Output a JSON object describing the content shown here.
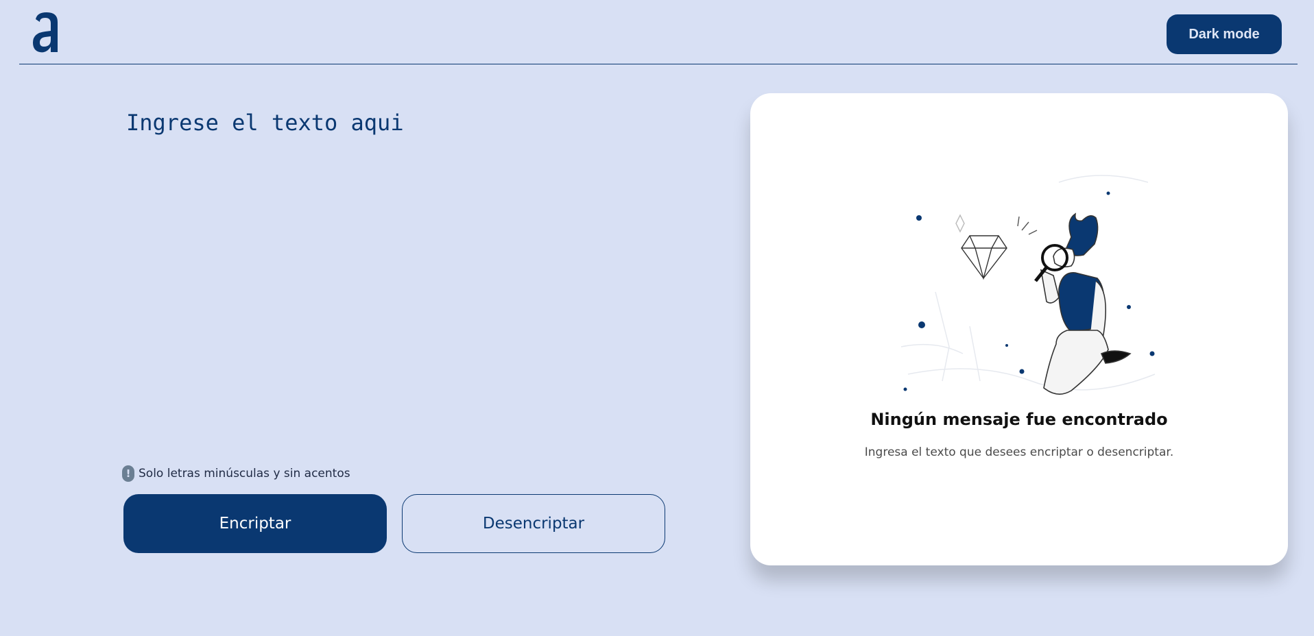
{
  "header": {
    "logo_icon": "alura-a-logo-icon",
    "dark_mode_label": "Dark mode"
  },
  "editor": {
    "placeholder": "Ingrese el texto aqui",
    "value": ""
  },
  "hint": {
    "icon": "exclamation-circle-icon",
    "icon_glyph": "!",
    "text": "Solo letras minúsculas y sin acentos"
  },
  "actions": {
    "encrypt_label": "Encriptar",
    "decrypt_label": "Desencriptar"
  },
  "result_panel": {
    "illustration": "person-with-magnifying-glass-illustration",
    "title": "Ningún mensaje fue encontrado",
    "subtitle": "Ingresa el texto que desees encriptar o desencriptar."
  },
  "colors": {
    "background": "#d8e0f4",
    "primary": "#0a3871",
    "card": "#ffffff"
  }
}
